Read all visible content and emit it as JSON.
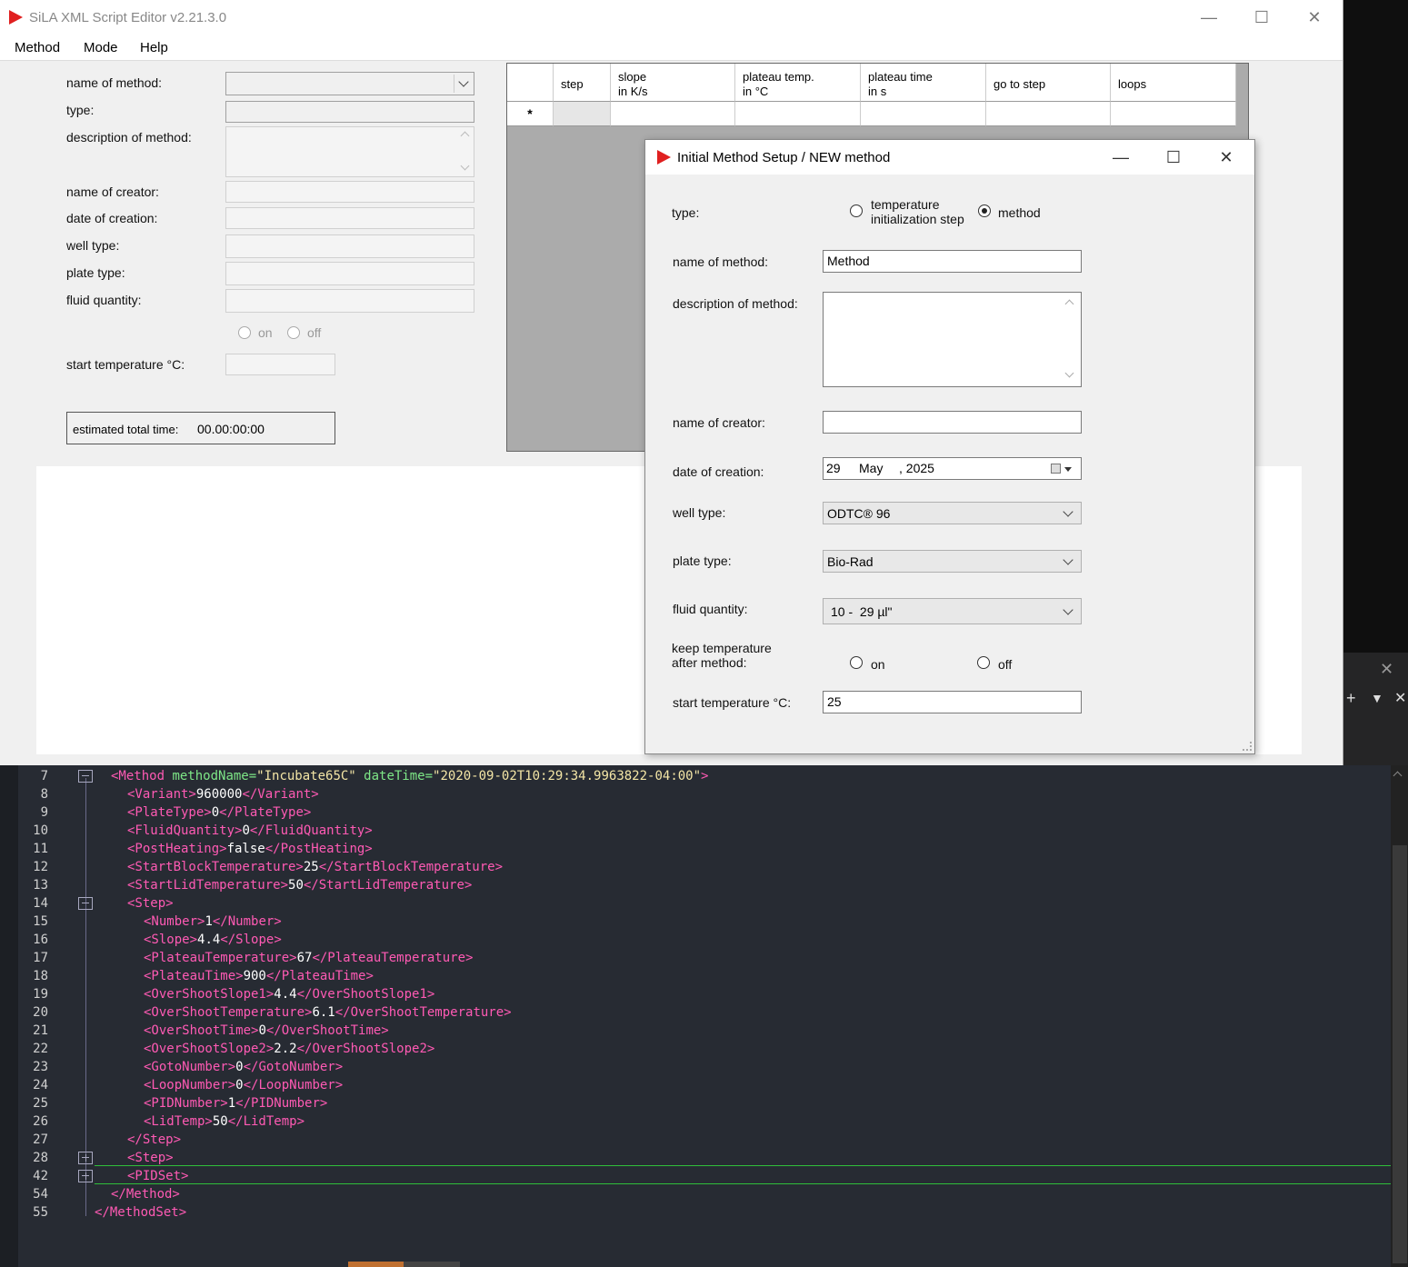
{
  "window": {
    "title": "SiLA XML Script Editor v2.21.3.0"
  },
  "menu": {
    "items": [
      "Method",
      "Mode",
      "Help"
    ]
  },
  "form": {
    "name_of_method": "name of method:",
    "type": "type:",
    "description": "description of method:",
    "name_of_creator": "name of creator:",
    "date_of_creation": "date of creation:",
    "well_type": "well type:",
    "plate_type": "plate type:",
    "fluid_quantity": "fluid quantity:",
    "on": "on",
    "off": "off",
    "start_temperature": "start temperature °C:",
    "estimated_label": "estimated total time:",
    "estimated_value": "00.00:00:00"
  },
  "grid": {
    "columns": [
      "step",
      "slope\nin K/s",
      "plateau temp.\nin °C",
      "plateau time\nin s",
      "go to step",
      "loops"
    ],
    "new_row_marker": "*"
  },
  "dialog": {
    "title": "Initial Method Setup / NEW method",
    "type_label": "type:",
    "type_option1": "temperature\ninitialization step",
    "type_option2": "method",
    "name_label": "name of method:",
    "name_value": "Method",
    "description_label": "description of method:",
    "creator_label": "name of creator:",
    "creator_value": "",
    "date_label": "date of creation:",
    "date_day": "29",
    "date_month": "May",
    "date_year": ", 2025",
    "well_label": "well type:",
    "well_value": "ODTC® 96",
    "plate_label": "plate type:",
    "plate_value": "Bio-Rad",
    "fluid_label": "fluid quantity:",
    "fluid_value": "10 -  29 µl\"",
    "keep_label": "keep temperature\nafter method:",
    "keep_on": "on",
    "keep_off": "off",
    "start_label": "start temperature °C:",
    "start_value": "25"
  },
  "side_panel": {
    "plus": "+",
    "dropdown": "▼"
  },
  "editor": {
    "lines": [
      {
        "n": "7",
        "indent": 1,
        "fold": "minus",
        "parts": [
          [
            "tag",
            "<Method "
          ],
          [
            "attr",
            "methodName="
          ],
          [
            "str",
            "\"Incubate65C\""
          ],
          [
            "attr",
            " dateTime="
          ],
          [
            "str",
            "\"2020-09-02T10:29:34.9963822-04:00\""
          ],
          [
            "tag",
            ">"
          ]
        ]
      },
      {
        "n": "8",
        "indent": 2,
        "parts": [
          [
            "tag",
            "<Variant>"
          ],
          [
            "txt",
            "960000"
          ],
          [
            "tag",
            "</Variant>"
          ]
        ]
      },
      {
        "n": "9",
        "indent": 2,
        "parts": [
          [
            "tag",
            "<PlateType>"
          ],
          [
            "txt",
            "0"
          ],
          [
            "tag",
            "</PlateType>"
          ]
        ]
      },
      {
        "n": "10",
        "indent": 2,
        "parts": [
          [
            "tag",
            "<FluidQuantity>"
          ],
          [
            "txt",
            "0"
          ],
          [
            "tag",
            "</FluidQuantity>"
          ]
        ]
      },
      {
        "n": "11",
        "indent": 2,
        "parts": [
          [
            "tag",
            "<PostHeating>"
          ],
          [
            "txt",
            "false"
          ],
          [
            "tag",
            "</PostHeating>"
          ]
        ]
      },
      {
        "n": "12",
        "indent": 2,
        "parts": [
          [
            "tag",
            "<StartBlockTemperature>"
          ],
          [
            "txt",
            "25"
          ],
          [
            "tag",
            "</StartBlockTemperature>"
          ]
        ]
      },
      {
        "n": "13",
        "indent": 2,
        "parts": [
          [
            "tag",
            "<StartLidTemperature>"
          ],
          [
            "txt",
            "50"
          ],
          [
            "tag",
            "</StartLidTemperature>"
          ]
        ]
      },
      {
        "n": "14",
        "indent": 2,
        "fold": "minus",
        "parts": [
          [
            "tag",
            "<Step>"
          ]
        ]
      },
      {
        "n": "15",
        "indent": 3,
        "parts": [
          [
            "tag",
            "<Number>"
          ],
          [
            "txt",
            "1"
          ],
          [
            "tag",
            "</Number>"
          ]
        ]
      },
      {
        "n": "16",
        "indent": 3,
        "parts": [
          [
            "tag",
            "<Slope>"
          ],
          [
            "txt",
            "4.4"
          ],
          [
            "tag",
            "</Slope>"
          ]
        ]
      },
      {
        "n": "17",
        "indent": 3,
        "parts": [
          [
            "tag",
            "<PlateauTemperature>"
          ],
          [
            "txt",
            "67"
          ],
          [
            "tag",
            "</PlateauTemperature>"
          ]
        ]
      },
      {
        "n": "18",
        "indent": 3,
        "parts": [
          [
            "tag",
            "<PlateauTime>"
          ],
          [
            "txt",
            "900"
          ],
          [
            "tag",
            "</PlateauTime>"
          ]
        ]
      },
      {
        "n": "19",
        "indent": 3,
        "parts": [
          [
            "tag",
            "<OverShootSlope1>"
          ],
          [
            "txt",
            "4.4"
          ],
          [
            "tag",
            "</OverShootSlope1>"
          ]
        ]
      },
      {
        "n": "20",
        "indent": 3,
        "parts": [
          [
            "tag",
            "<OverShootTemperature>"
          ],
          [
            "txt",
            "6.1"
          ],
          [
            "tag",
            "</OverShootTemperature>"
          ]
        ]
      },
      {
        "n": "21",
        "indent": 3,
        "parts": [
          [
            "tag",
            "<OverShootTime>"
          ],
          [
            "txt",
            "0"
          ],
          [
            "tag",
            "</OverShootTime>"
          ]
        ]
      },
      {
        "n": "22",
        "indent": 3,
        "parts": [
          [
            "tag",
            "<OverShootSlope2>"
          ],
          [
            "txt",
            "2.2"
          ],
          [
            "tag",
            "</OverShootSlope2>"
          ]
        ]
      },
      {
        "n": "23",
        "indent": 3,
        "parts": [
          [
            "tag",
            "<GotoNumber>"
          ],
          [
            "txt",
            "0"
          ],
          [
            "tag",
            "</GotoNumber>"
          ]
        ]
      },
      {
        "n": "24",
        "indent": 3,
        "parts": [
          [
            "tag",
            "<LoopNumber>"
          ],
          [
            "txt",
            "0"
          ],
          [
            "tag",
            "</LoopNumber>"
          ]
        ]
      },
      {
        "n": "25",
        "indent": 3,
        "parts": [
          [
            "tag",
            "<PIDNumber>"
          ],
          [
            "txt",
            "1"
          ],
          [
            "tag",
            "</PIDNumber>"
          ]
        ]
      },
      {
        "n": "26",
        "indent": 3,
        "parts": [
          [
            "tag",
            "<LidTemp>"
          ],
          [
            "txt",
            "50"
          ],
          [
            "tag",
            "</LidTemp>"
          ]
        ]
      },
      {
        "n": "27",
        "indent": 2,
        "parts": [
          [
            "tag",
            "</Step>"
          ]
        ]
      },
      {
        "n": "28",
        "indent": 2,
        "fold": "plus",
        "parts": [
          [
            "tag",
            "<Step>"
          ]
        ]
      },
      {
        "n": "42",
        "indent": 2,
        "fold": "plus",
        "parts": [
          [
            "tag",
            "<PIDSet>"
          ]
        ]
      },
      {
        "n": "54",
        "indent": 1,
        "parts": [
          [
            "tag",
            "</Method>"
          ]
        ]
      },
      {
        "n": "55",
        "indent": 0,
        "parts": [
          [
            "tag",
            "</MethodSet>"
          ]
        ]
      }
    ]
  }
}
